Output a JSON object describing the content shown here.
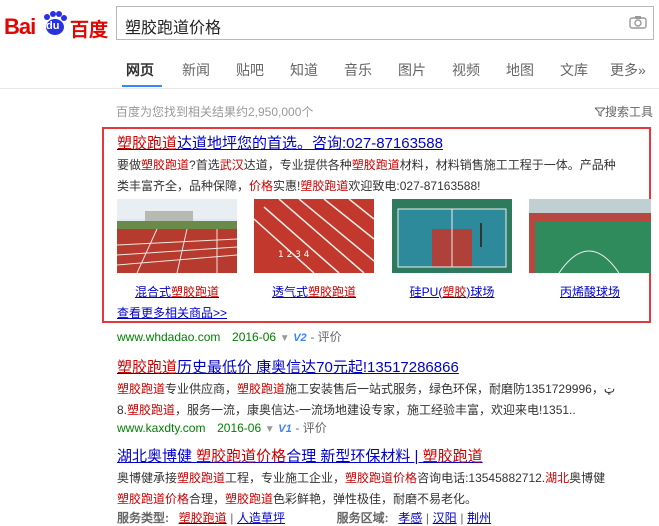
{
  "header": {
    "logo_bai": "Bai",
    "logo_du": "du",
    "logo_cn": "百度",
    "query": "塑胶跑道价格"
  },
  "nav": [
    "网页",
    "新闻",
    "贴吧",
    "知道",
    "音乐",
    "图片",
    "视频",
    "地图",
    "文库",
    "更多»"
  ],
  "info": {
    "result_count": "百度为您找到相关结果约2,950,000个",
    "tools": "搜索工具"
  },
  "ad": {
    "title_em": "塑胶跑道",
    "title_rest": "达道地坪您的首选。咨询:027-87163588",
    "desc_line1": [
      "要做",
      "塑胶跑道",
      "?首选",
      "武汉",
      "达道，专业提供各种",
      "塑胶跑道",
      "材料，材料销售施工工程于一体。产品种"
    ],
    "desc_line2": [
      "类丰富齐全，品种保障，",
      "价格",
      "实惠!",
      "塑胶跑道",
      "欢迎致电:027-87163588!"
    ],
    "captions": [
      {
        "pre": "混合式",
        "em": "塑胶跑道",
        "post": ""
      },
      {
        "pre": "透气式",
        "em": "塑胶跑道",
        "post": ""
      },
      {
        "pre": "硅PU(",
        "em": "塑胶",
        "post": ")球场"
      },
      {
        "pre": "丙烯酸球场",
        "em": "",
        "post": ""
      }
    ],
    "more": "查看更多相关商品>>",
    "url": "www.whdadao.com",
    "date": "2016-06",
    "v": "V2",
    "eval": "- 评价"
  },
  "result2": {
    "title_em": "塑胶跑道",
    "title_rest": "历史最低价 康奥信达70元起!13517286866",
    "desc_line1": [
      "塑胶跑道",
      "专业供应商，",
      "塑胶跑道",
      "施工安装售后一站式服务，绿色环保，耐磨防ټ，1351729996"
    ],
    "desc_line2": [
      "8.",
      "塑胶跑道",
      "，服务一流，康奥信达-一流场地建设专家，施工经验丰富，欢迎来电!1351.."
    ],
    "url": "www.kaxdty.com",
    "date": "2016-06",
    "v": "V1",
    "eval": "- 评价"
  },
  "result3": {
    "title": [
      "湖北奥博健 ",
      "塑胶跑道价格",
      "合理 新型环保材料 | ",
      "塑胶跑道"
    ],
    "desc_line1": [
      "奥博健承接",
      "塑胶跑道",
      "工程，专业施工企业，",
      "塑胶跑道价格",
      "咨询电话:13545882712.",
      "湖北",
      "奥博健"
    ],
    "desc_line2": [
      "塑胶跑道价格",
      "合理，",
      "塑胶跑道",
      "色彩鲜艳，弹性极佳，耐磨不易老化。"
    ],
    "service_type_label": "服务类型:",
    "service_types": [
      "塑胶跑道",
      "人造草坪"
    ],
    "service_area_label": "服务区域:",
    "service_areas": [
      "孝感",
      "汉阳",
      "荆州"
    ]
  },
  "colors": {
    "accent_blue": "#3388ff",
    "link": "#0000cc",
    "em": "#cc0000",
    "url": "#008000",
    "ad_border": "#e4393c"
  }
}
